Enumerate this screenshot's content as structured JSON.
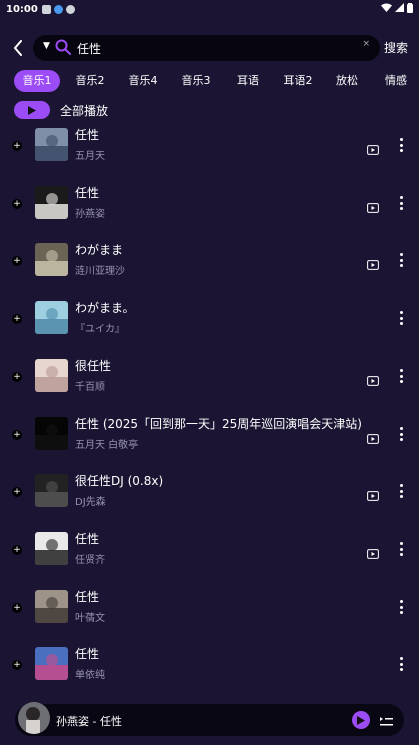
{
  "status": {
    "time": "10:00"
  },
  "search": {
    "query": "任性",
    "submit_label": "搜索",
    "drop_label": "▼",
    "clear_label": "×"
  },
  "tabs": [
    "音乐1",
    "音乐2",
    "音乐4",
    "音乐3",
    "耳语",
    "耳语2",
    "放松",
    "情感"
  ],
  "active_tab": 0,
  "playall_label": "全部播放",
  "songs": [
    {
      "title": "任性",
      "artist": "五月天",
      "mv": true
    },
    {
      "title": "任性",
      "artist": "孙燕姿",
      "mv": true
    },
    {
      "title": "わがまま",
      "artist": "涟川亚理沙",
      "mv": true
    },
    {
      "title": "わがまま。",
      "artist": "『ユイカ』",
      "mv": false
    },
    {
      "title": "很任性",
      "artist": "千百顺",
      "mv": true
    },
    {
      "title": "任性 (2025「回到那一天」25周年巡回演唱会天津站)",
      "artist": "五月天 白敬亭",
      "mv": true
    },
    {
      "title": "很任性DJ (0.8x)",
      "artist": "DJ先森",
      "mv": true
    },
    {
      "title": "任性",
      "artist": "任贤齐",
      "mv": true
    },
    {
      "title": "任性",
      "artist": "叶蒨文",
      "mv": false
    },
    {
      "title": "任性",
      "artist": "单依纯",
      "mv": false
    }
  ],
  "now_playing": {
    "text": "孙燕姿 - 任性"
  },
  "colors": {
    "accent": "#9b4cf5",
    "background": "#1b1533",
    "secondary_text": "#9893ad"
  }
}
